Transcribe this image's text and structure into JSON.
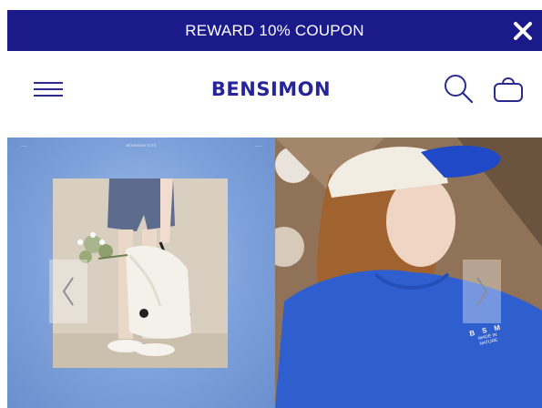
{
  "promo": {
    "text": "REWARD 10% COUPON",
    "background": "#1a1a8a",
    "close_icon": "close-icon"
  },
  "header": {
    "logo": "BENSIMON",
    "brand_color": "#26249a",
    "menu_icon": "hamburger-menu-icon",
    "search_icon": "search-icon",
    "bag_icon": "shopping-bag-icon"
  },
  "hero": {
    "left_slide_header": [
      "——",
      "BENSIMON TOTE",
      "——"
    ],
    "shirt_print": [
      "B S M",
      "MADE IN",
      "NATURE"
    ],
    "prev_icon": "chevron-left-icon",
    "next_icon": "chevron-right-icon"
  }
}
